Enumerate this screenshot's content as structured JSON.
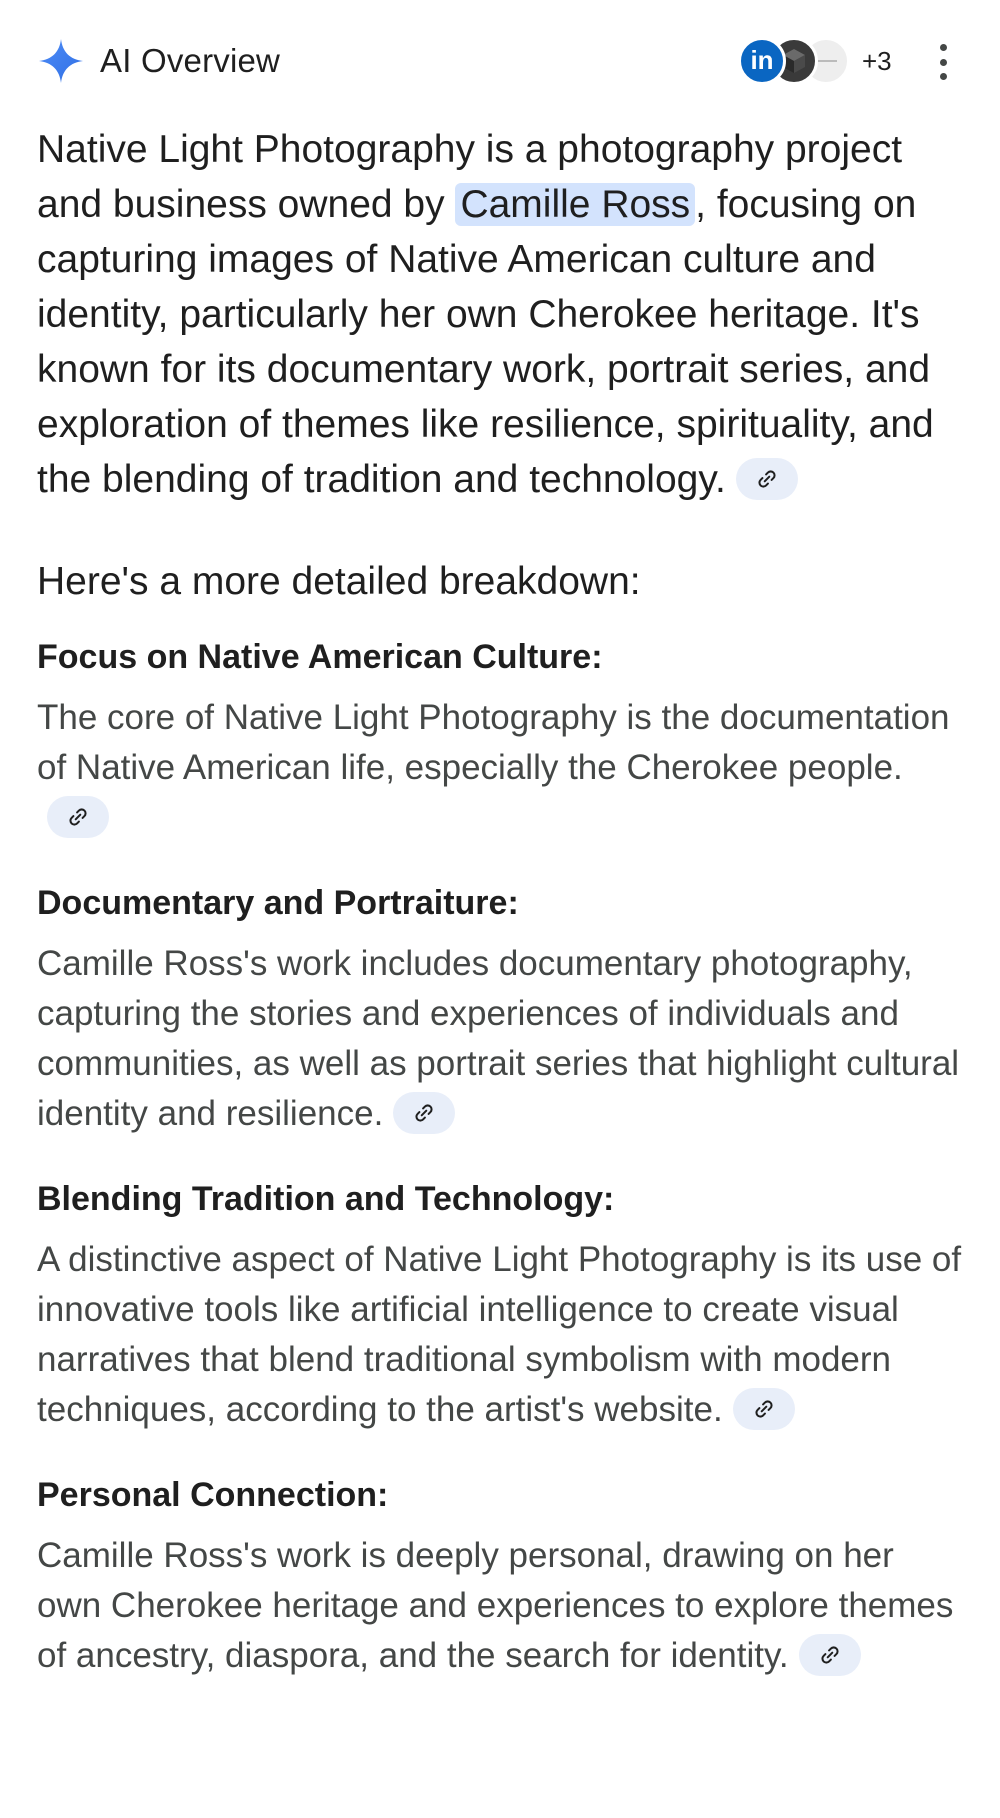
{
  "header": {
    "title": "AI Overview",
    "sources_more": "+3",
    "source_avatars": [
      {
        "icon": "linkedin-icon",
        "text": "in"
      },
      {
        "icon": "cube-site-icon"
      },
      {
        "icon": "site-logo-icon"
      }
    ]
  },
  "intro": {
    "before": "Native Light Photography is a photography project and business owned by ",
    "highlight": "Camille Ross",
    "after": ", focusing on capturing images of Native American culture and identity, particularly her own Cherokee heritage. It's known for its documentary work, portrait series, and exploration of themes like resilience, spirituality, and the blending of tradition and technology."
  },
  "breakdown_heading": "Here's a more detailed breakdown:",
  "sections": [
    {
      "title": "Focus on Native American Culture:",
      "body": "The core of Native Light Photography is the documentation of Native American life, especially the Cherokee people."
    },
    {
      "title": "Documentary and Portraiture:",
      "body": "Camille Ross's work includes documentary photography, capturing the stories and experiences of individuals and communities, as well as portrait series that highlight cultural identity and resilience."
    },
    {
      "title": "Blending Tradition and Technology:",
      "body": "A distinctive aspect of Native Light Photography is its use of innovative tools like artificial intelligence to create visual narratives that blend traditional symbolism with modern techniques, according to the artist's website."
    },
    {
      "title": "Personal Connection:",
      "body": "Camille Ross's work is deeply personal, drawing on her own Cherokee heritage and experiences to explore themes of ancestry, diaspora, and the search for identity."
    }
  ],
  "colors": {
    "accent_blue": "#4285f4",
    "highlight_bg": "#d3e3fd",
    "chip_bg": "#e8eef9",
    "body_text": "#444746",
    "heading_text": "#1f1f1f"
  },
  "icons": {
    "sparkle": "gemini-sparkle-icon",
    "link": "link-icon",
    "menu": "more-vert-icon"
  }
}
